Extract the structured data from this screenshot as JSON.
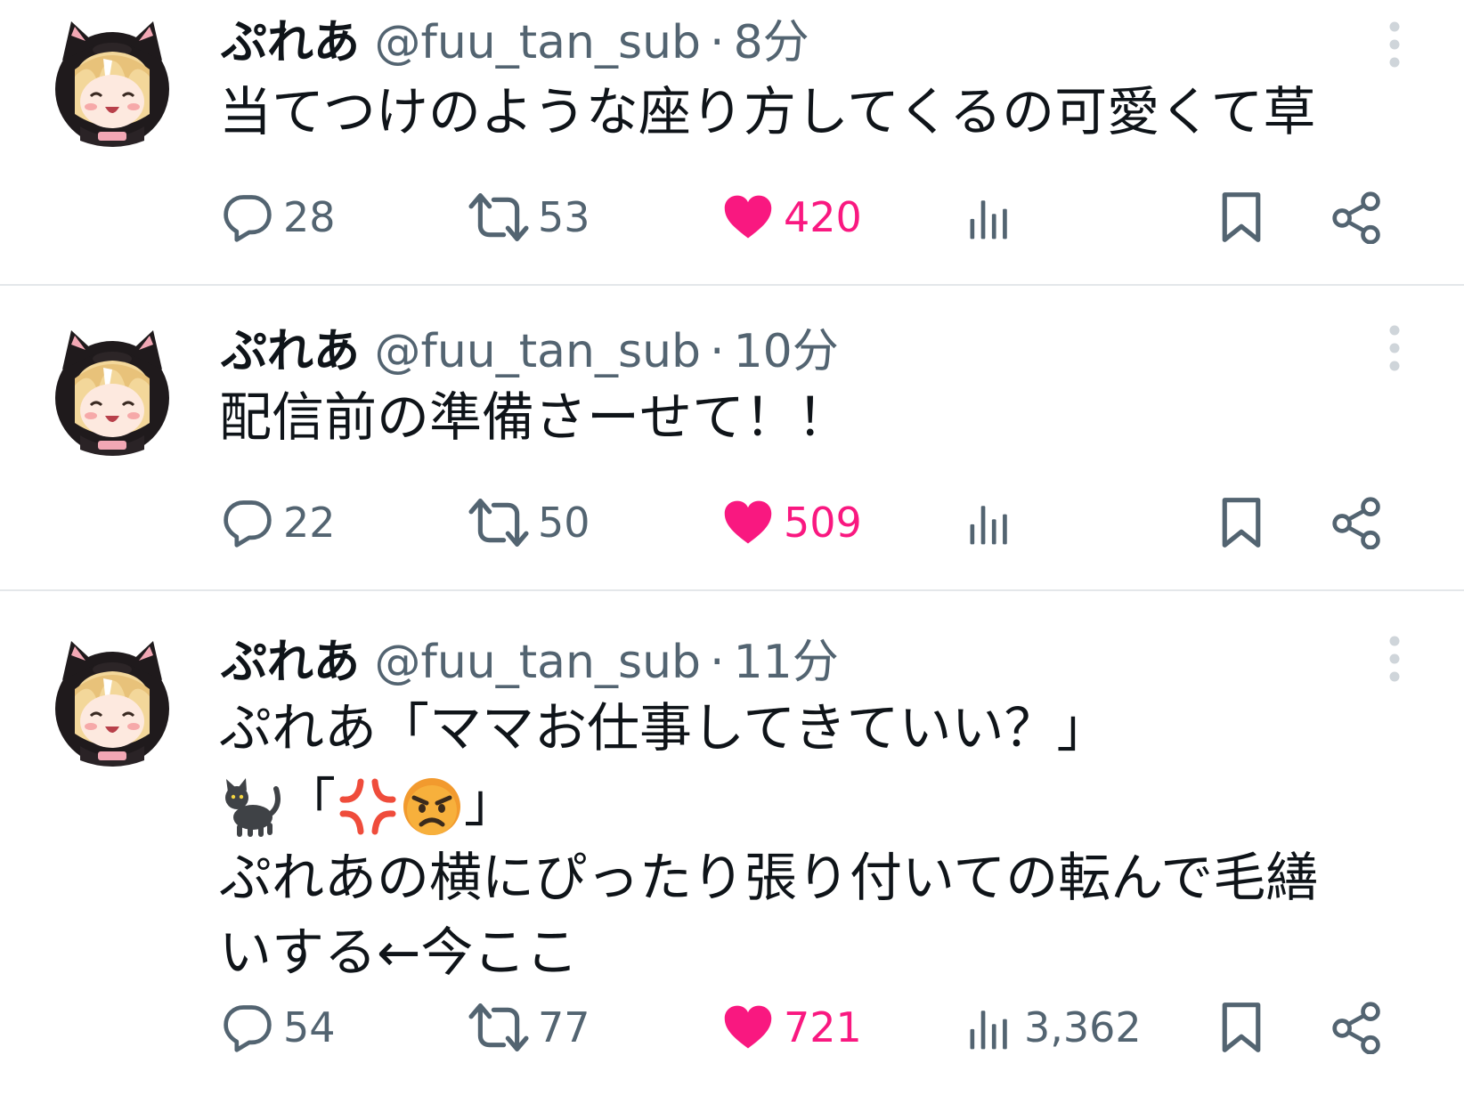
{
  "colors": {
    "text_primary": "#0f1419",
    "text_secondary": "#536471",
    "like_active": "#f91880",
    "divider": "#e4e7ea"
  },
  "tweets": [
    {
      "display_name": "ぷれあ",
      "handle": "@fuu_tan_sub",
      "separator": "·",
      "time": "8分",
      "body": [
        "当てつけのような座り方してくるの可愛くて草"
      ],
      "replies": "28",
      "retweets": "53",
      "likes": "420",
      "liked": true,
      "views": "",
      "icons": [
        "avatar",
        "more-icon",
        "reply-icon",
        "retweet-icon",
        "heart-icon",
        "views-icon",
        "bookmark-icon",
        "share-icon"
      ]
    },
    {
      "display_name": "ぷれあ",
      "handle": "@fuu_tan_sub",
      "separator": "·",
      "time": "10分",
      "body": [
        "配信前の準備さーせて！！"
      ],
      "replies": "22",
      "retweets": "50",
      "likes": "509",
      "liked": true,
      "views": "",
      "icons": [
        "avatar",
        "more-icon",
        "reply-icon",
        "retweet-icon",
        "heart-icon",
        "views-icon",
        "bookmark-icon",
        "share-icon"
      ]
    },
    {
      "display_name": "ぷれあ",
      "handle": "@fuu_tan_sub",
      "separator": "·",
      "time": "11分",
      "body": [
        "ぷれあ「ママお仕事してきていい？」",
        "「",
        "」",
        "ぷれあの横にぴったり張り付いての転んで毛繕",
        "いする←今ここ"
      ],
      "emoji_line": [
        "black-cat-emoji",
        "anger-symbol-emoji",
        "angry-face-emoji"
      ],
      "replies": "54",
      "retweets": "77",
      "likes": "721",
      "liked": true,
      "views": "3,362",
      "icons": [
        "avatar",
        "more-icon",
        "reply-icon",
        "retweet-icon",
        "heart-icon",
        "views-icon",
        "bookmark-icon",
        "share-icon"
      ]
    }
  ]
}
